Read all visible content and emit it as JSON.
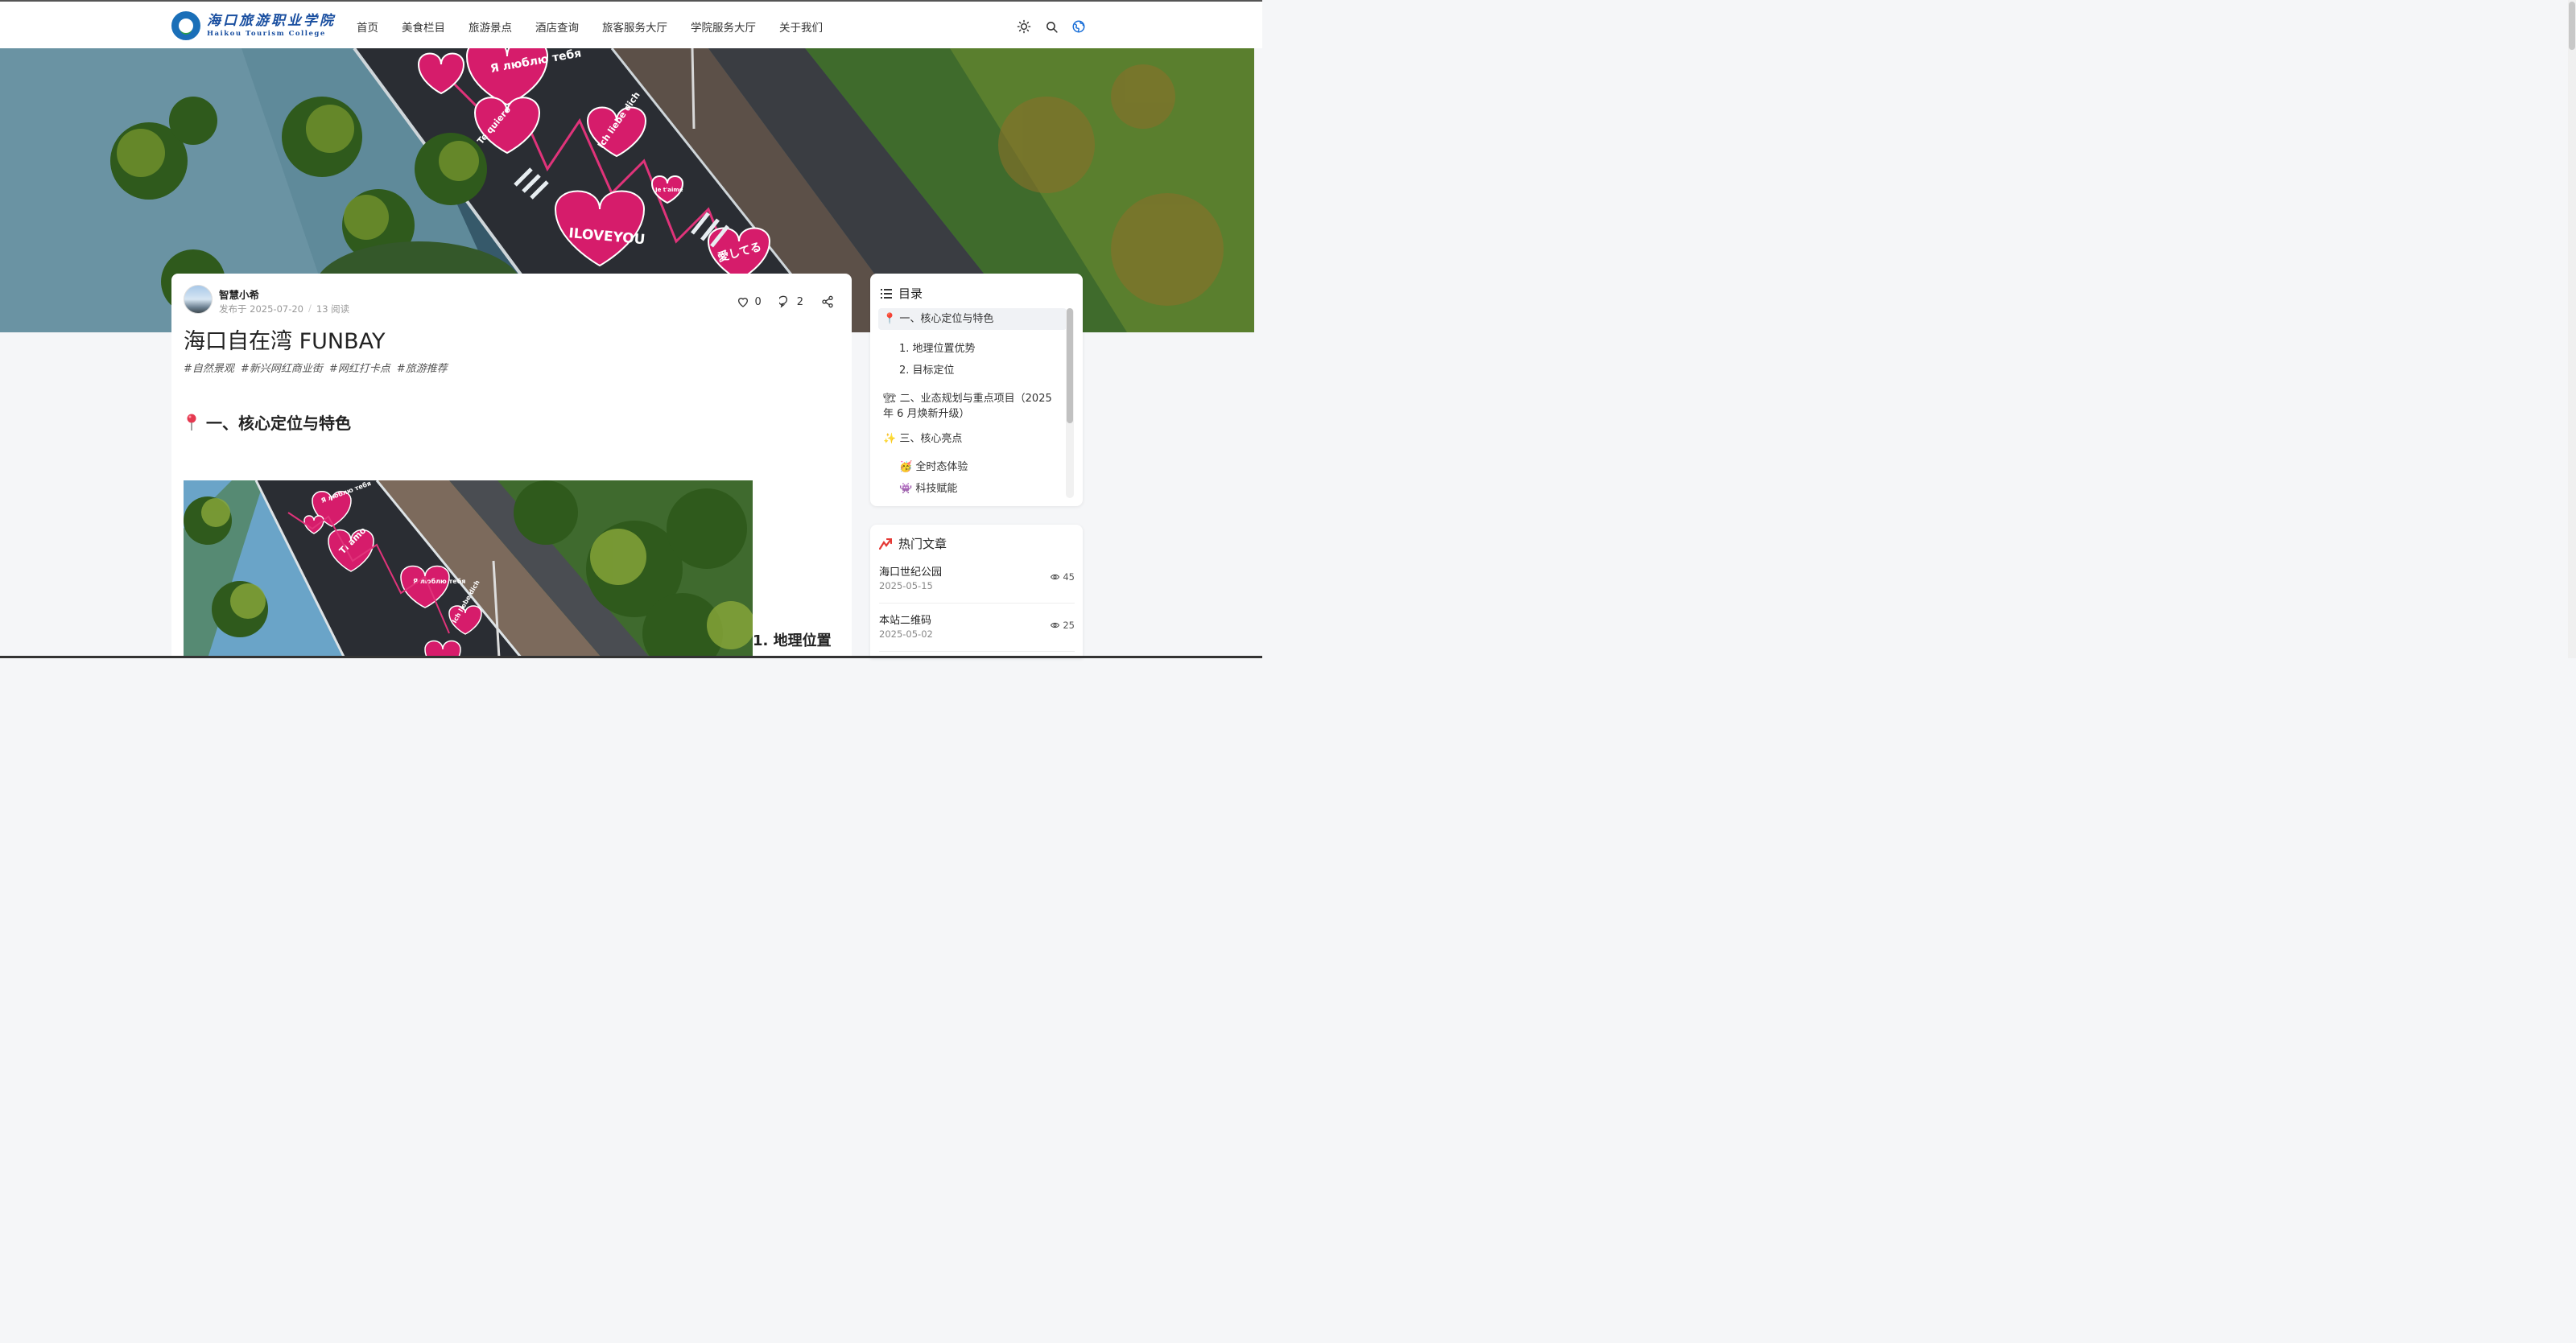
{
  "header": {
    "logo_cn": "海口旅游职业学院",
    "logo_en": "Haikou Tourism College",
    "nav": [
      "首页",
      "美食栏目",
      "旅游景点",
      "酒店查询",
      "旅客服务大厅",
      "学院服务大厅",
      "关于我们"
    ],
    "icons": [
      "sun-icon",
      "search-icon",
      "globe-icon"
    ]
  },
  "hero": {
    "texts": [
      "Я люблю тебя",
      "Ich liebe dich",
      "Te quiero",
      "ILOVEYOU",
      "愛してる",
      "Je t'aime"
    ]
  },
  "article": {
    "author": "智慧小希",
    "published": "发布于 2025-07-20",
    "reads": "13 阅读",
    "likes": "0",
    "comments": "2",
    "title": "海口自在湾 FUNBAY",
    "tags": [
      "#自然景观",
      "#新兴网红商业街",
      "#网红打卡点",
      "#旅游推荐"
    ],
    "section1": "一、核心定位与特色",
    "subsection1": "1. 地理位置",
    "photo_texts": [
      "Я люблю тебя",
      "Ti amo",
      "Я люблю тебя",
      "Ich liebe dich",
      "Te quiero"
    ]
  },
  "toc": {
    "title": "目录",
    "items": [
      {
        "label": "一、核心定位与特色",
        "icon": "📍",
        "level": 1,
        "active": true
      },
      {
        "label": "1. 地理位置优势",
        "level": 2
      },
      {
        "label": "2. 目标定位",
        "level": 2
      },
      {
        "label": "二、业态规划与重点项目（2025年 6 月焕新升级）",
        "icon": "🏗",
        "level": 1
      },
      {
        "label": "三、核心亮点",
        "icon": "✨",
        "level": 1
      },
      {
        "label": "全时态体验",
        "icon": "🥳",
        "level": 2
      },
      {
        "label": "科技赋能",
        "icon": "👾",
        "level": 2
      }
    ]
  },
  "hot": {
    "title": "热门文章",
    "items": [
      {
        "title": "海口世纪公园",
        "date": "2025-05-15",
        "views": "45"
      },
      {
        "title": "本站二维码",
        "date": "2025-05-02",
        "views": "25"
      }
    ]
  },
  "colors": {
    "accent": "#1a4fa0",
    "heart_pink": "#d61c6b",
    "hot_icon": "#e53935"
  }
}
